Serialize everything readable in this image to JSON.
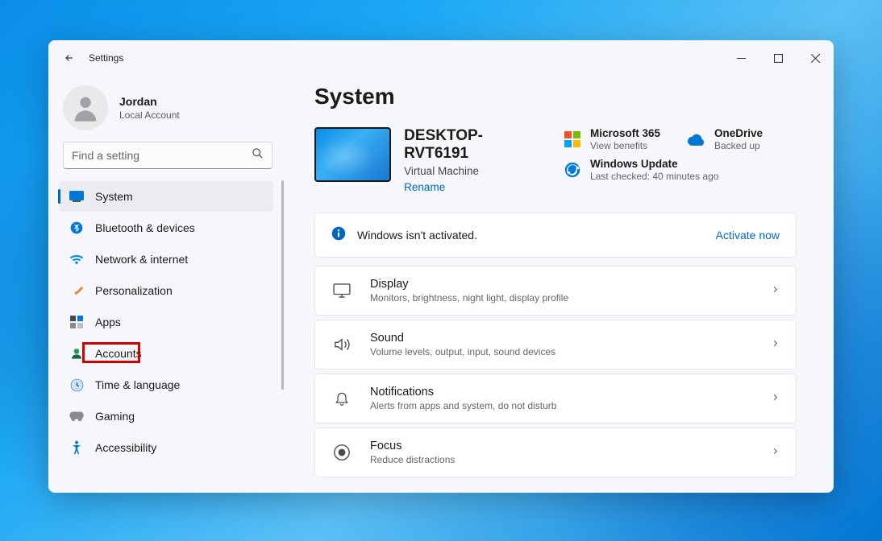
{
  "titlebar": {
    "title": "Settings"
  },
  "user": {
    "name": "Jordan",
    "type": "Local Account"
  },
  "search": {
    "placeholder": "Find a setting"
  },
  "sidebar": {
    "items": [
      {
        "label": "System"
      },
      {
        "label": "Bluetooth & devices"
      },
      {
        "label": "Network & internet"
      },
      {
        "label": "Personalization"
      },
      {
        "label": "Apps"
      },
      {
        "label": "Accounts"
      },
      {
        "label": "Time & language"
      },
      {
        "label": "Gaming"
      },
      {
        "label": "Accessibility"
      }
    ]
  },
  "page": {
    "title": "System"
  },
  "device": {
    "name": "DESKTOP-RVT6191",
    "sub": "Virtual Machine",
    "rename": "Rename"
  },
  "tiles": {
    "ms365": {
      "title": "Microsoft 365",
      "sub": "View benefits"
    },
    "onedrive": {
      "title": "OneDrive",
      "sub": "Backed up"
    },
    "update": {
      "title": "Windows Update",
      "sub": "Last checked: 40 minutes ago"
    }
  },
  "banner": {
    "text": "Windows isn't activated.",
    "action": "Activate now"
  },
  "settings": [
    {
      "title": "Display",
      "sub": "Monitors, brightness, night light, display profile"
    },
    {
      "title": "Sound",
      "sub": "Volume levels, output, input, sound devices"
    },
    {
      "title": "Notifications",
      "sub": "Alerts from apps and system, do not disturb"
    },
    {
      "title": "Focus",
      "sub": "Reduce distractions"
    }
  ]
}
